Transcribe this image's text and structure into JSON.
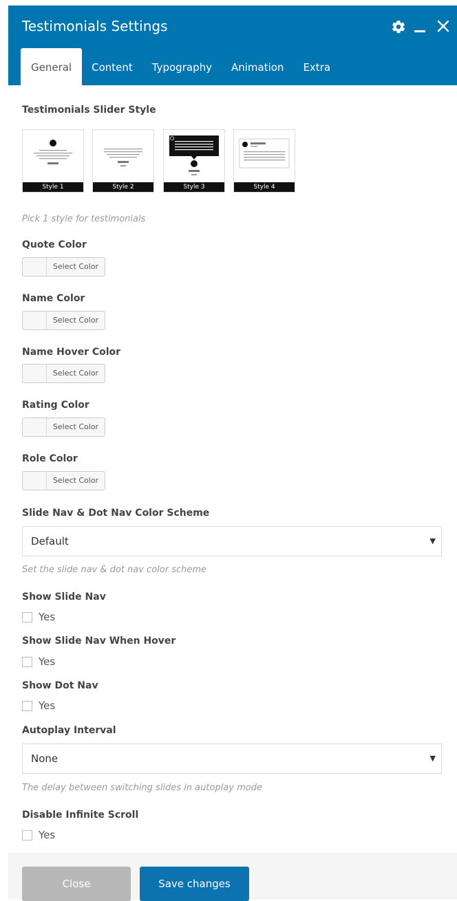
{
  "window": {
    "title": "Testimonials Settings"
  },
  "tabs": [
    {
      "label": "General"
    },
    {
      "label": "Content"
    },
    {
      "label": "Typography"
    },
    {
      "label": "Animation"
    },
    {
      "label": "Extra"
    }
  ],
  "slider_style": {
    "label": "Testimonials Slider Style",
    "options": [
      {
        "caption": "Style 1"
      },
      {
        "caption": "Style 2"
      },
      {
        "caption": "Style 3"
      },
      {
        "caption": "Style 4"
      }
    ],
    "help": "Pick 1 style for testimonials"
  },
  "colors": [
    {
      "label": "Quote Color",
      "button": "Select Color"
    },
    {
      "label": "Name Color",
      "button": "Select Color"
    },
    {
      "label": "Name Hover Color",
      "button": "Select Color"
    },
    {
      "label": "Rating Color",
      "button": "Select Color"
    },
    {
      "label": "Role Color",
      "button": "Select Color"
    }
  ],
  "nav_scheme": {
    "label": "Slide Nav & Dot Nav Color Scheme",
    "value": "Default",
    "help": "Set the slide nav & dot nav color scheme"
  },
  "show_slide_nav": {
    "label": "Show Slide Nav",
    "option": "Yes",
    "checked": false
  },
  "show_slide_nav_hover": {
    "label": "Show Slide Nav When Hover",
    "option": "Yes",
    "checked": false
  },
  "show_dot_nav": {
    "label": "Show Dot Nav",
    "option": "Yes",
    "checked": false
  },
  "autoplay": {
    "label": "Autoplay Interval",
    "value": "None",
    "help": "The delay between switching slides in autoplay mode"
  },
  "disable_infinite": {
    "label": "Disable Infinite Scroll",
    "option": "Yes",
    "checked": false
  },
  "footer": {
    "close_label": "Close",
    "save_label": "Save changes"
  },
  "theme": {
    "header_bg": "#0075b0",
    "save_button": "#0d72b0",
    "close_button": "#b8b8b8"
  }
}
